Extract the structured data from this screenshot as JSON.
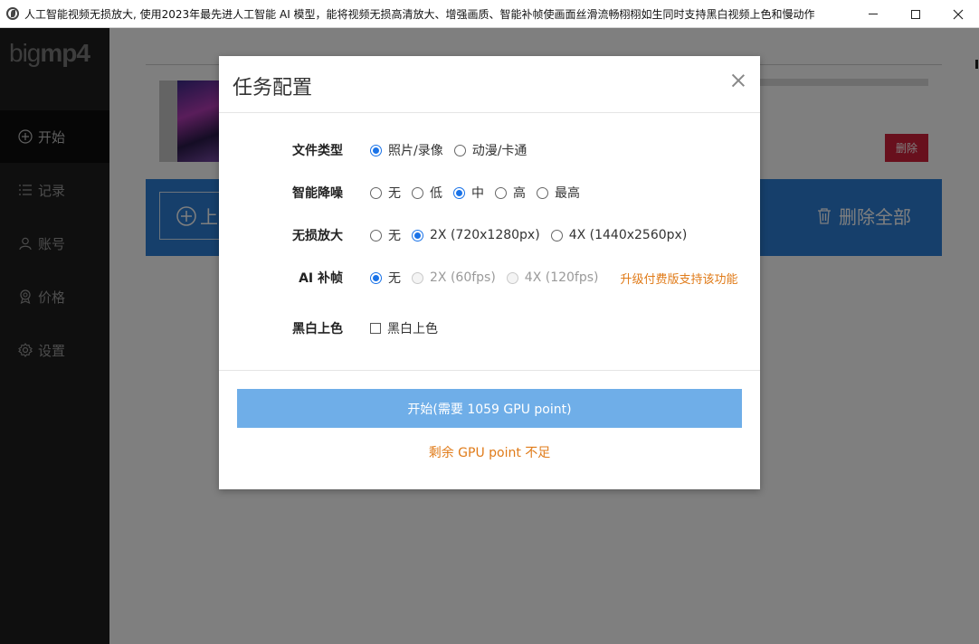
{
  "window": {
    "title": "人工智能视频无损放大, 使用2023年最先进人工智能 AI 模型，能将视频无损高清放大、增强画质、智能补帧使画面丝滑流畅栩栩如生同时支持黑白视频上色和慢动作",
    "controls": {
      "minimize": "minimize",
      "maximize": "maximize",
      "close": "close"
    }
  },
  "sidebar": {
    "logo_part1": "big",
    "logo_part2": "mp4",
    "items": [
      {
        "label": "开始",
        "icon": "plus-circle-icon",
        "active": true
      },
      {
        "label": "记录",
        "icon": "list-icon",
        "active": false
      },
      {
        "label": "账号",
        "icon": "user-icon",
        "active": false
      },
      {
        "label": "价格",
        "icon": "badge-icon",
        "active": false
      },
      {
        "label": "设置",
        "icon": "gear-icon",
        "active": false
      }
    ]
  },
  "main": {
    "delete_label": "删除",
    "upload_label": "上",
    "delete_all_label": "删除全部"
  },
  "dialog": {
    "title": "任务配置",
    "file_type": {
      "label": "文件类型",
      "options": [
        "照片/录像",
        "动漫/卡通"
      ],
      "selected": "照片/录像"
    },
    "denoise": {
      "label": "智能降噪",
      "options": [
        "无",
        "低",
        "中",
        "高",
        "最高"
      ],
      "selected": "中"
    },
    "upscale": {
      "label": "无损放大",
      "options": [
        "无",
        "2X (720x1280px)",
        "4X (1440x2560px)"
      ],
      "selected": "2X (720x1280px)"
    },
    "interpolation": {
      "label": "AI 补帧",
      "options": [
        "无",
        "2X (60fps)",
        "4X (120fps)"
      ],
      "selected": "无",
      "upgrade_note": "升级付费版支持该功能"
    },
    "colorize": {
      "label": "黑白上色",
      "checkbox_label": "黑白上色",
      "checked": false
    },
    "start_button": "开始(需要 1059 GPU point)",
    "warning": "剩余 GPU point 不足",
    "colors": {
      "accent": "#1a73e8",
      "warning": "#e07b19",
      "start_button": "#6faee8"
    }
  }
}
